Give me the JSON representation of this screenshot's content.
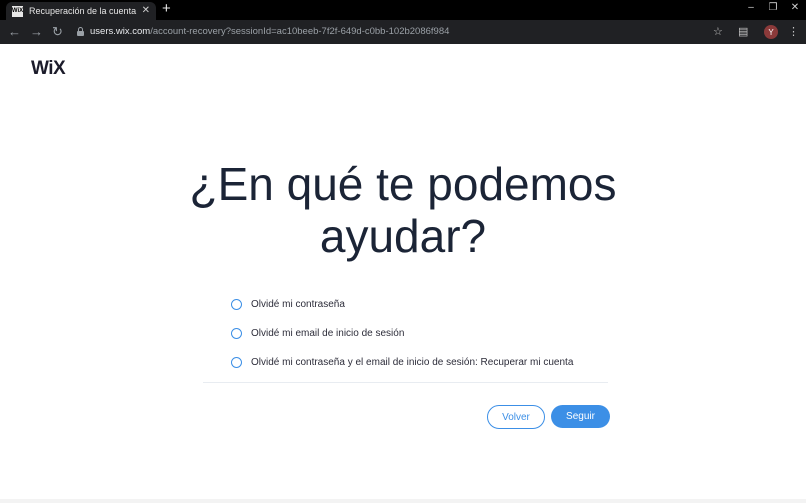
{
  "browser": {
    "tab_title": "Recuperación de la cuenta",
    "favicon_text": "WiX",
    "url_host": "users.wix.com",
    "url_path": "/account-recovery?sessionId=ac10beeb-7f2f-649d-c0bb-102b2086f984",
    "profile_initial": "Y"
  },
  "page": {
    "logo": "WiX",
    "heading_line1": "¿En qué te podemos",
    "heading_line2": "ayudar?",
    "options": [
      "Olvidé mi contraseña",
      "Olvidé mi email de inicio de sesión",
      "Olvidé mi contraseña y el email de inicio de sesión: Recuperar mi cuenta"
    ],
    "back_label": "Volver",
    "next_label": "Seguir"
  },
  "colors": {
    "accent": "#3c8fe6",
    "heading": "#1b2436"
  }
}
